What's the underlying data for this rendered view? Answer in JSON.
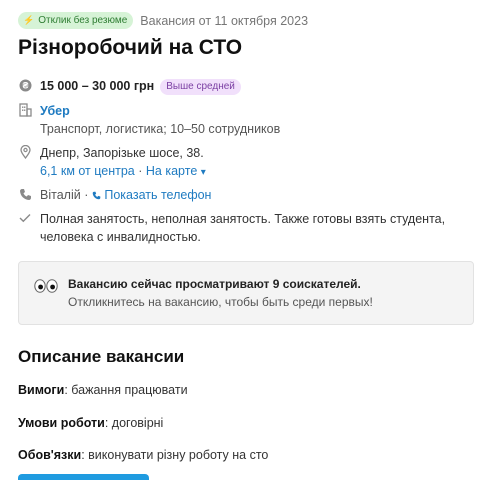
{
  "badge_no_resume": "Отклик без резюме",
  "published": "Вакансия от 11 октября 2023",
  "title": "Різноробочий на СТО",
  "salary": {
    "amount": "15 000 – 30 000 грн",
    "badge": "Выше средней"
  },
  "company": {
    "name": "Убер",
    "details": "Транспорт, логистика; 10–50 сотрудников"
  },
  "address": {
    "line": "Днепр, Запорізьке шосе, 38.",
    "distance": "6,1 км от центра",
    "separator": "·",
    "map_link": "На карте",
    "map_chevron": "▾"
  },
  "contact": {
    "name": "Віталій",
    "separator": "·",
    "phone_link": "Показать телефон"
  },
  "employment": {
    "line1": "Полная занятость, неполная занятость. Также готовы взять студента,",
    "line2": "человека с инвалидностью."
  },
  "viewers": {
    "title": "Вакансию сейчас просматривают 9 соискателей.",
    "subtitle": "Откликнитесь на вакансию, чтобы быть среди первых!"
  },
  "description": {
    "heading": "Описание вакансии",
    "items": [
      {
        "label": "Вимоги",
        "value": ": бажання працювати"
      },
      {
        "label": "Умови роботи",
        "value": ": договірні"
      },
      {
        "label": "Обов'язки",
        "value": ": виконувати різну роботу на сто"
      }
    ]
  },
  "icons": {
    "bolt": "lightning-bolt-icon",
    "salary": "currency-coin-icon",
    "company": "building-icon",
    "address": "map-pin-icon",
    "phone": "phone-icon",
    "employment": "checkmark-icon",
    "eyes": "eyes-icon"
  },
  "colors": {
    "link": "#1f7bc1",
    "green_badge_bg": "#d6f3d6",
    "purple_badge_bg": "#f1e0fb",
    "cta": "#1f9be0"
  }
}
